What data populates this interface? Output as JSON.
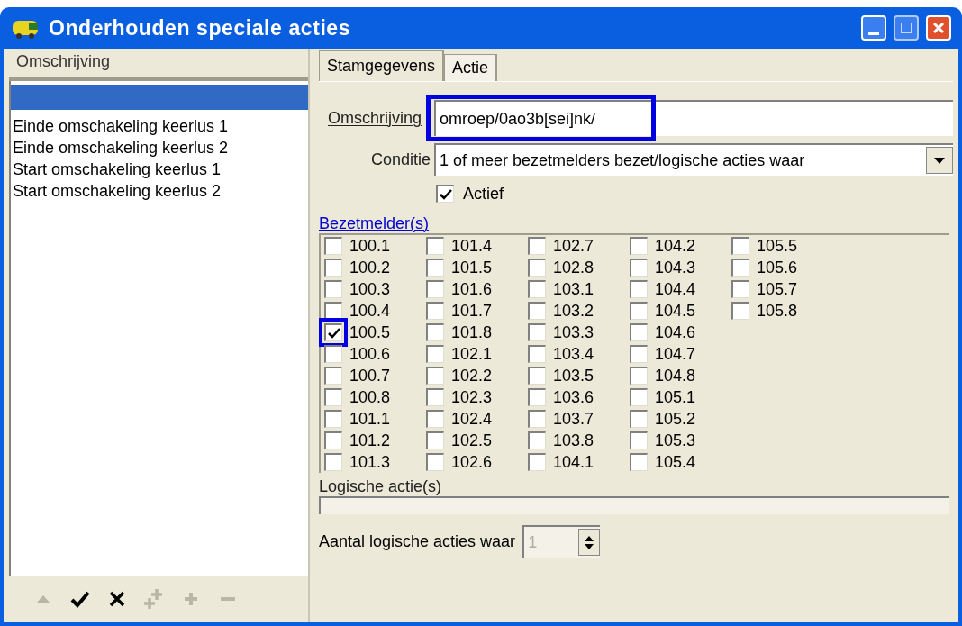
{
  "window": {
    "title": "Onderhouden speciale acties"
  },
  "list": {
    "header": "Omschrijving",
    "items": [
      {
        "selected": true
      },
      {
        "label": "Einde omschakeling keerlus 1",
        "selected": false
      },
      {
        "label": "Einde omschakeling keerlus 2",
        "selected": false
      },
      {
        "label": "Start omschakeling keerlus 1",
        "selected": false
      },
      {
        "label": "Start omschakeling keerlus 2",
        "selected": false
      }
    ]
  },
  "toolbar": [
    {
      "kind": "up",
      "disabled": true
    },
    {
      "kind": "check",
      "disabled": false
    },
    {
      "kind": "cross",
      "disabled": false
    },
    {
      "kind": "sparkle",
      "disabled": true
    },
    {
      "kind": "plus",
      "disabled": true
    },
    {
      "kind": "minus",
      "disabled": true
    }
  ],
  "tabs": [
    {
      "label": "Stamgegevens",
      "selected": true
    },
    {
      "label": "Actie",
      "selected": false
    }
  ],
  "omschrijving": {
    "label": "Omschrijving",
    "value": "omroep/0ao3b[sei]nk/",
    "highlighted": true
  },
  "conditie": {
    "label": "Conditie",
    "value": "1 of meer bezetmelders bezet/logische acties waar"
  },
  "actief": {
    "label": "Actief",
    "checked": true
  },
  "bezetmelders": {
    "label": "Bezetmelder(s)",
    "items": [
      {
        "label": "100.1",
        "checked": false,
        "highlighted": false
      },
      {
        "label": "100.2",
        "checked": false,
        "highlighted": false
      },
      {
        "label": "100.3",
        "checked": false,
        "highlighted": false
      },
      {
        "label": "100.4",
        "checked": false,
        "highlighted": false
      },
      {
        "label": "100.5",
        "checked": true,
        "highlighted": true
      },
      {
        "label": "100.6",
        "checked": false,
        "highlighted": false
      },
      {
        "label": "100.7",
        "checked": false,
        "highlighted": false
      },
      {
        "label": "100.8",
        "checked": false,
        "highlighted": false
      },
      {
        "label": "101.1",
        "checked": false,
        "highlighted": false
      },
      {
        "label": "101.2",
        "checked": false,
        "highlighted": false
      },
      {
        "label": "101.3",
        "checked": false,
        "highlighted": false
      },
      {
        "label": "101.4",
        "checked": false,
        "highlighted": false
      },
      {
        "label": "101.5",
        "checked": false,
        "highlighted": false
      },
      {
        "label": "101.6",
        "checked": false,
        "highlighted": false
      },
      {
        "label": "101.7",
        "checked": false,
        "highlighted": false
      },
      {
        "label": "101.8",
        "checked": false,
        "highlighted": false
      },
      {
        "label": "102.1",
        "checked": false,
        "highlighted": false
      },
      {
        "label": "102.2",
        "checked": false,
        "highlighted": false
      },
      {
        "label": "102.3",
        "checked": false,
        "highlighted": false
      },
      {
        "label": "102.4",
        "checked": false,
        "highlighted": false
      },
      {
        "label": "102.5",
        "checked": false,
        "highlighted": false
      },
      {
        "label": "102.6",
        "checked": false,
        "highlighted": false
      },
      {
        "label": "102.7",
        "checked": false,
        "highlighted": false
      },
      {
        "label": "102.8",
        "checked": false,
        "highlighted": false
      },
      {
        "label": "103.1",
        "checked": false,
        "highlighted": false
      },
      {
        "label": "103.2",
        "checked": false,
        "highlighted": false
      },
      {
        "label": "103.3",
        "checked": false,
        "highlighted": false
      },
      {
        "label": "103.4",
        "checked": false,
        "highlighted": false
      },
      {
        "label": "103.5",
        "checked": false,
        "highlighted": false
      },
      {
        "label": "103.6",
        "checked": false,
        "highlighted": false
      },
      {
        "label": "103.7",
        "checked": false,
        "highlighted": false
      },
      {
        "label": "103.8",
        "checked": false,
        "highlighted": false
      },
      {
        "label": "104.1",
        "checked": false,
        "highlighted": false
      },
      {
        "label": "104.2",
        "checked": false,
        "highlighted": false
      },
      {
        "label": "104.3",
        "checked": false,
        "highlighted": false
      },
      {
        "label": "104.4",
        "checked": false,
        "highlighted": false
      },
      {
        "label": "104.5",
        "checked": false,
        "highlighted": false
      },
      {
        "label": "104.6",
        "checked": false,
        "highlighted": false
      },
      {
        "label": "104.7",
        "checked": false,
        "highlighted": false
      },
      {
        "label": "104.8",
        "checked": false,
        "highlighted": false
      },
      {
        "label": "105.1",
        "checked": false,
        "highlighted": false
      },
      {
        "label": "105.2",
        "checked": false,
        "highlighted": false
      },
      {
        "label": "105.3",
        "checked": false,
        "highlighted": false
      },
      {
        "label": "105.4",
        "checked": false,
        "highlighted": false
      },
      {
        "label": "105.5",
        "checked": false,
        "highlighted": false
      },
      {
        "label": "105.6",
        "checked": false,
        "highlighted": false
      },
      {
        "label": "105.7",
        "checked": false,
        "highlighted": false
      },
      {
        "label": "105.8",
        "checked": false,
        "highlighted": false
      }
    ]
  },
  "logische_acties": {
    "label": "Logische actie(s)"
  },
  "aantal": {
    "label": "Aantal logische acties waar",
    "value": "1",
    "disabled": true
  }
}
